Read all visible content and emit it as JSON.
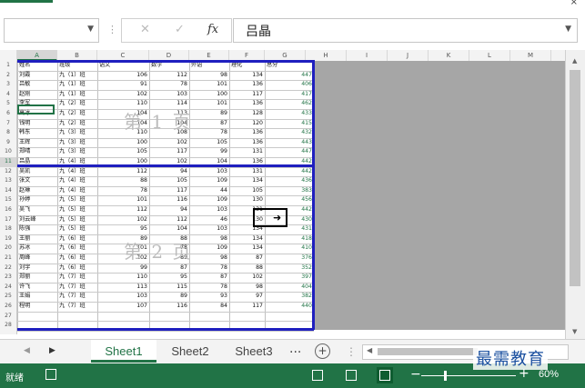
{
  "formula_bar": {
    "name_box_value": "",
    "cancel_icon": "✕",
    "enter_icon": "✓",
    "fx_label": "fx",
    "formula_value": "吕晶"
  },
  "columns": [
    "A",
    "B",
    "C",
    "D",
    "E",
    "F",
    "G",
    "H",
    "I",
    "J",
    "K",
    "L",
    "M"
  ],
  "rows": [
    "1",
    "2",
    "3",
    "4",
    "5",
    "6",
    "7",
    "8",
    "9",
    "10",
    "11",
    "12",
    "13",
    "14",
    "15",
    "16",
    "17",
    "18",
    "19",
    "20",
    "21",
    "22",
    "23",
    "24",
    "25",
    "26",
    "27",
    "28"
  ],
  "table": {
    "headers": [
      "姓名",
      "班级",
      "语文",
      "数学",
      "外语",
      "理化",
      "总分"
    ],
    "data": [
      [
        "刘霞",
        "九（1）班",
        "106",
        "112",
        "98",
        "134",
        "447"
      ],
      [
        "吕敏",
        "九（1）班",
        "91",
        "78",
        "101",
        "136",
        "406"
      ],
      [
        "赵刚",
        "九（1）班",
        "102",
        "103",
        "100",
        "117",
        "417"
      ],
      [
        "李军",
        "九（2）班",
        "110",
        "114",
        "101",
        "136",
        "462"
      ],
      [
        "高冰",
        "九（2）班",
        "104",
        "113",
        "89",
        "128",
        "433"
      ],
      [
        "钱明",
        "九（2）班",
        "104",
        "104",
        "87",
        "120",
        "415"
      ],
      [
        "韩东",
        "九（3）班",
        "110",
        "108",
        "78",
        "136",
        "432"
      ],
      [
        "王辉",
        "九（3）班",
        "100",
        "102",
        "105",
        "136",
        "443"
      ],
      [
        "郑晴",
        "九（3）班",
        "105",
        "117",
        "99",
        "131",
        "447"
      ],
      [
        "吕晶",
        "九（4）班",
        "100",
        "102",
        "104",
        "136",
        "442"
      ],
      [
        "吴凯",
        "九（4）班",
        "112",
        "94",
        "103",
        "131",
        "442"
      ],
      [
        "张文",
        "九（4）班",
        "88",
        "105",
        "109",
        "134",
        "436"
      ],
      [
        "赵琳",
        "九（4）班",
        "78",
        "117",
        "44",
        "105",
        "383"
      ],
      [
        "孙婷",
        "九（5）班",
        "101",
        "116",
        "109",
        "130",
        "456"
      ],
      [
        "吴飞",
        "九（5）班",
        "112",
        "94",
        "103",
        "131",
        "442"
      ],
      [
        "刘云峰",
        "九（5）班",
        "102",
        "112",
        "46",
        "130",
        "430"
      ],
      [
        "陈强",
        "九（5）班",
        "95",
        "104",
        "103",
        "134",
        "431"
      ],
      [
        "王丽",
        "九（6）班",
        "89",
        "88",
        "98",
        "134",
        "418"
      ],
      [
        "苏冰",
        "九（6）班",
        "101",
        "78",
        "109",
        "134",
        "410"
      ],
      [
        "周峰",
        "九（6）班",
        "102",
        "89",
        "98",
        "87",
        "376"
      ],
      [
        "刘宇",
        "九（6）班",
        "99",
        "87",
        "78",
        "88",
        "352"
      ],
      [
        "郑丽",
        "九（7）班",
        "110",
        "95",
        "87",
        "102",
        "397"
      ],
      [
        "许飞",
        "九（7）班",
        "113",
        "115",
        "78",
        "98",
        "404"
      ],
      [
        "王娟",
        "九（7）班",
        "103",
        "89",
        "93",
        "97",
        "382"
      ],
      [
        "程明",
        "九（7）班",
        "107",
        "116",
        "84",
        "117",
        "440"
      ]
    ]
  },
  "watermarks": {
    "page1": "第 1 页",
    "page2": "第 2 页"
  },
  "sheets": [
    "Sheet1",
    "Sheet2",
    "Sheet3"
  ],
  "active_sheet": "Sheet1",
  "tabbar": {
    "ellipsis": "...",
    "add_icon": "+"
  },
  "status": {
    "ready": "就绪",
    "zoom": "60%"
  },
  "logo_text": "最需教育",
  "colors": {
    "accent": "#217346",
    "page_break": "#1f1fbf",
    "outside_area": "#a6a6a6"
  }
}
